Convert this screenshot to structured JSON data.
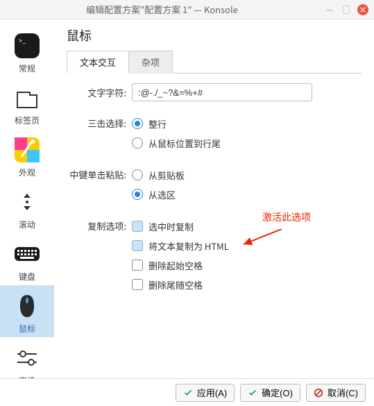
{
  "window": {
    "title": "编辑配置方案\"配置方案 1\" — Konsole"
  },
  "sidebar": {
    "items": [
      {
        "label": "常规"
      },
      {
        "label": "标签页"
      },
      {
        "label": "外观"
      },
      {
        "label": "滚动"
      },
      {
        "label": "键盘"
      },
      {
        "label": "鼠标"
      },
      {
        "label": "高级"
      }
    ]
  },
  "page": {
    "title": "鼠标",
    "tabs": [
      {
        "label": "文本交互",
        "active": true
      },
      {
        "label": "杂项",
        "active": false
      }
    ],
    "chars_label": "文字字符:",
    "chars_value": ":@-./_~?&=%+#",
    "triple_click_label": "三击选择:",
    "triple_click_options": [
      {
        "label": "整行",
        "selected": true
      },
      {
        "label": "从鼠标位置到行尾",
        "selected": false
      }
    ],
    "middle_paste_label": "中键单击粘贴:",
    "middle_paste_options": [
      {
        "label": "从剪贴板",
        "selected": false
      },
      {
        "label": "从选区",
        "selected": true
      }
    ],
    "copy_options_label": "复制选项:",
    "copy_options": [
      {
        "label": "选中时复制",
        "state": "partial"
      },
      {
        "label": "将文本复制为 HTML",
        "state": "partial"
      },
      {
        "label": "删除起始空格",
        "state": "off"
      },
      {
        "label": "删除尾随空格",
        "state": "off"
      }
    ]
  },
  "annotation": "激活此选项",
  "footer": {
    "apply": "应用(A)",
    "ok": "确定(O)",
    "cancel": "取消(C)"
  },
  "icons": {
    "terminal": "terminal-icon",
    "tab": "tab-icon",
    "appearance": "appearance-icon",
    "scroll": "scroll-icon",
    "keyboard": "keyboard-icon",
    "mouse": "mouse-icon",
    "advanced": "advanced-icon"
  }
}
